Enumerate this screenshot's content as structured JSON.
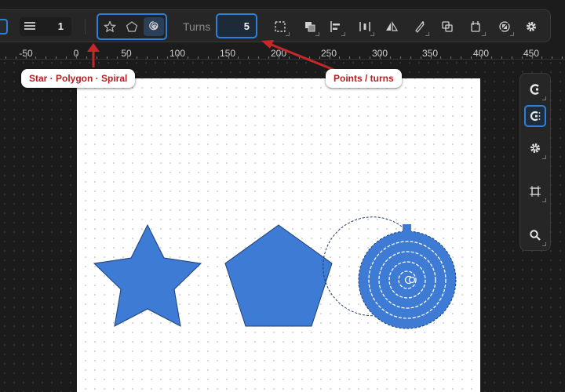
{
  "toolbar": {
    "stroke_width_value": "1",
    "shape_options": [
      {
        "name": "star",
        "icon": "star-icon",
        "active": false
      },
      {
        "name": "polygon",
        "icon": "pentagon-icon",
        "active": false
      },
      {
        "name": "spiral",
        "icon": "spiral-icon",
        "active": true
      }
    ],
    "turns_label": "Turns",
    "turns_value": "5",
    "tools": [
      "selection-icon",
      "layer-order-icon",
      "align-left-icon",
      "distribute-icon",
      "flip-icon",
      "pen-edit-icon",
      "duplicate-icon",
      "add-frame-icon",
      "clip-icon",
      "settings-gear-icon"
    ]
  },
  "ruler": {
    "labels": [
      "-50",
      "0",
      "50",
      "100",
      "150",
      "200",
      "250",
      "300",
      "350",
      "400",
      "450"
    ]
  },
  "annotations": {
    "shape_types_callout": "Star · Polygon · Spiral",
    "points_turns_callout": "Points / turns"
  },
  "right_panel": {
    "buttons": [
      "snap-icon",
      "snap-grid-icon",
      "gear-icon",
      "frame-crop-icon",
      "zoom-icon"
    ],
    "active": "snap-grid-icon"
  },
  "canvas": {
    "shapes": [
      {
        "type": "star",
        "points": 5,
        "fill": "#3d7bd5"
      },
      {
        "type": "polygon",
        "sides": 5,
        "fill": "#3d7bd5"
      },
      {
        "type": "spiral",
        "turns": 5,
        "fill": "#3d7bd5",
        "selected": true
      }
    ]
  },
  "colors": {
    "accent": "#2f7fd8",
    "shape_fill": "#3d7bd5",
    "callout_text": "#b21f1f",
    "arrow": "#c62828"
  }
}
